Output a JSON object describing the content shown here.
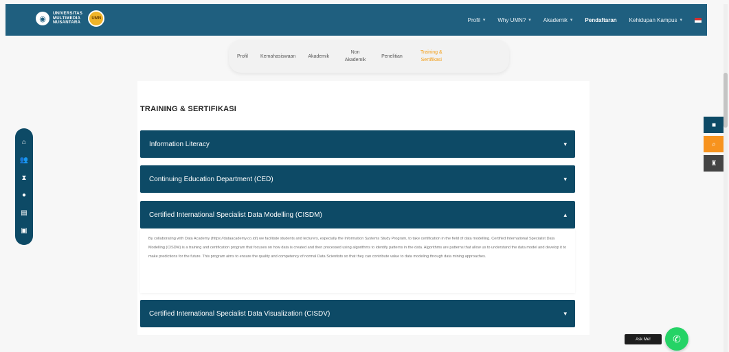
{
  "header": {
    "logo_line1": "UNIVERSITAS",
    "logo_line2": "MULTIMEDIA",
    "logo_line3": "NUSANTARA",
    "badge_text": "UMN",
    "nav": [
      {
        "label": "Profil",
        "has_chevron": true,
        "bold": false
      },
      {
        "label": "Why UMN?",
        "has_chevron": true,
        "bold": false
      },
      {
        "label": "Akademik",
        "has_chevron": true,
        "bold": false
      },
      {
        "label": "Pendaftaran",
        "has_chevron": false,
        "bold": true
      },
      {
        "label": "Kehidupan Kampus",
        "has_chevron": true,
        "bold": false
      }
    ]
  },
  "subtabs": [
    {
      "label": "Profil"
    },
    {
      "label": "Kemahasiswaan"
    },
    {
      "label": "Akademik"
    },
    {
      "label": "Non Akademik"
    },
    {
      "label": "Penelitian"
    },
    {
      "label": "Training & Sertifikasi",
      "active": true
    }
  ],
  "section": {
    "title": "TRAINING & SERTIFIKASI"
  },
  "accordions": [
    {
      "title": "Information Literacy",
      "expanded": false
    },
    {
      "title": "Continuing Education Department (CED)",
      "expanded": false
    },
    {
      "title": "Certified International Specialist Data Modelling (CISDM)",
      "expanded": true,
      "body": "By collaborating with Data Academy (https://dataacademy.co.id/) we facilitate students and lecturers, especially the Information Systems Study Program, to take certification in the field of data modelling. Certified International Specialist Data Modelling (CISDM) is a training and certification program that focuses on how data is created and then processed using algorithms to identify patterns in the data. Algorithms are patterns that allow us to understand the data model and develop it to make predictions for the future. This program aims to ensure the quality and competency of normal Data Scientists so that they can contribute value to data modeling through data mining approaches."
    },
    {
      "title": "Certified International Specialist Data Visualization (CISDV)",
      "expanded": false
    }
  ],
  "icons": {
    "arrow_down": "▾",
    "arrow_up": "▴",
    "chevron": "▾"
  },
  "chat": {
    "label": "Ask Me!"
  },
  "colors": {
    "header_bg": "#1f5f7f",
    "accordion_bg": "#0d4a66",
    "active_tab": "#f39c12",
    "chat_green": "#25d366",
    "right_orange": "#f7931e",
    "right_dark": "#444444"
  }
}
